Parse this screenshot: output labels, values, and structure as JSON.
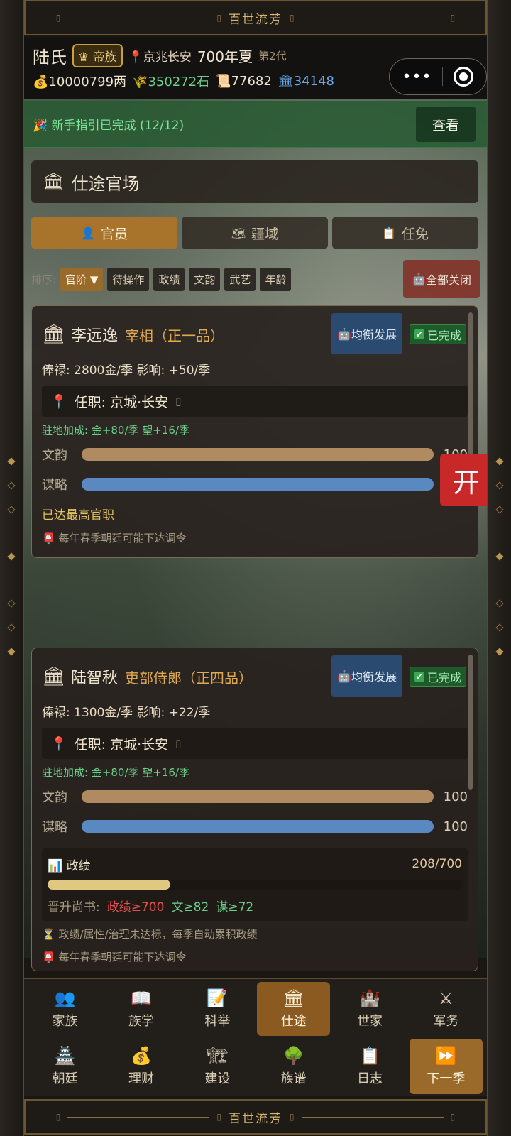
{
  "banner": {
    "title": "百世流芳"
  },
  "header": {
    "family_name": "陆氏",
    "rank_badge": "帝族",
    "location": "京兆长安",
    "year": "700年夏",
    "generation": "第2代",
    "money": "10000799两",
    "grain": "350272石",
    "scrolls": "77682",
    "treasury": "34148"
  },
  "guide": {
    "text": "新手指引已完成 (12/12)",
    "button": "查看"
  },
  "section": {
    "title": "仕途官场"
  },
  "tabs": [
    {
      "label": "官员",
      "icon": "person-icon",
      "active": true
    },
    {
      "label": "疆域",
      "icon": "map-icon",
      "active": false
    },
    {
      "label": "任免",
      "icon": "clipboard-icon",
      "active": false
    }
  ],
  "sort": {
    "label": "排序:",
    "options": [
      "官阶 ▼",
      "待操作",
      "政绩",
      "文韵",
      "武艺",
      "年龄"
    ],
    "close_all": "全部关闭"
  },
  "float_button": "开",
  "officials": [
    {
      "name": "李远逸",
      "title": "宰相（正一品）",
      "strategy": "均衡发展",
      "status": "已完成",
      "salary_line": "俸禄: 2800金/季   影响: +50/季",
      "post": "任职: 京城·长安",
      "bonus": "驻地加成: 金+80/季  望+16/季",
      "attr1_label": "文韵",
      "attr1_value": "100",
      "attr2_label": "谋略",
      "attr2_value": "",
      "max_rank": "已达最高官职",
      "note": "每年春季朝廷可能下达调令"
    },
    {
      "name": "陆智秋",
      "title": "吏部侍郎（正四品）",
      "strategy": "均衡发展",
      "status": "已完成",
      "salary_line": "俸禄: 1300金/季   影响: +22/季",
      "post": "任职: 京城·长安",
      "bonus": "驻地加成: 金+80/季  望+16/季",
      "attr1_label": "文韵",
      "attr1_value": "100",
      "attr2_label": "谋略",
      "attr2_value": "100",
      "perf_label": "政绩",
      "perf_value": "208/700",
      "perf_progress": 0.297,
      "promo_label": "晋升尚书:",
      "promo_req1": "政绩≥700",
      "promo_req2": "文≥82",
      "promo_req3": "谋≥72",
      "warning": "政绩/属性/治理未达标，每季自动累积政绩",
      "note": "每年春季朝廷可能下达调令"
    }
  ],
  "nav": [
    {
      "label": "家族",
      "icon": "family-icon"
    },
    {
      "label": "族学",
      "icon": "book-icon"
    },
    {
      "label": "科举",
      "icon": "memo-icon"
    },
    {
      "label": "仕途",
      "icon": "government-icon"
    },
    {
      "label": "世家",
      "icon": "castle-icon"
    },
    {
      "label": "军务",
      "icon": "swords-icon"
    },
    {
      "label": "朝廷",
      "icon": "pagoda-icon"
    },
    {
      "label": "理财",
      "icon": "moneybag-icon"
    },
    {
      "label": "建设",
      "icon": "crane-icon"
    },
    {
      "label": "族谱",
      "icon": "tree-icon"
    },
    {
      "label": "日志",
      "icon": "log-icon"
    },
    {
      "label": "下一季",
      "icon": "fast-forward-icon"
    }
  ]
}
